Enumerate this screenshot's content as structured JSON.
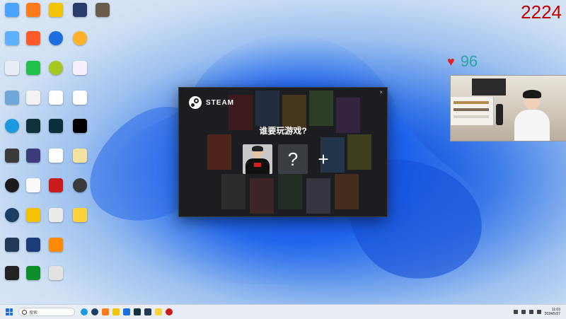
{
  "overlay": {
    "counter": "2224",
    "like_count": "96"
  },
  "steam_dialog": {
    "brand": "STEAM",
    "prompt": "谁要玩游戏?",
    "unknown_label": "?",
    "add_label": "+",
    "close_label": "×"
  },
  "taskbar": {
    "search_placeholder": "搜索",
    "clock_time": "11:03",
    "clock_date": "2024/5/27"
  },
  "colors": {
    "counter": "#c00000",
    "like_heart": "#e02020",
    "like_number": "#2aa6a0"
  }
}
